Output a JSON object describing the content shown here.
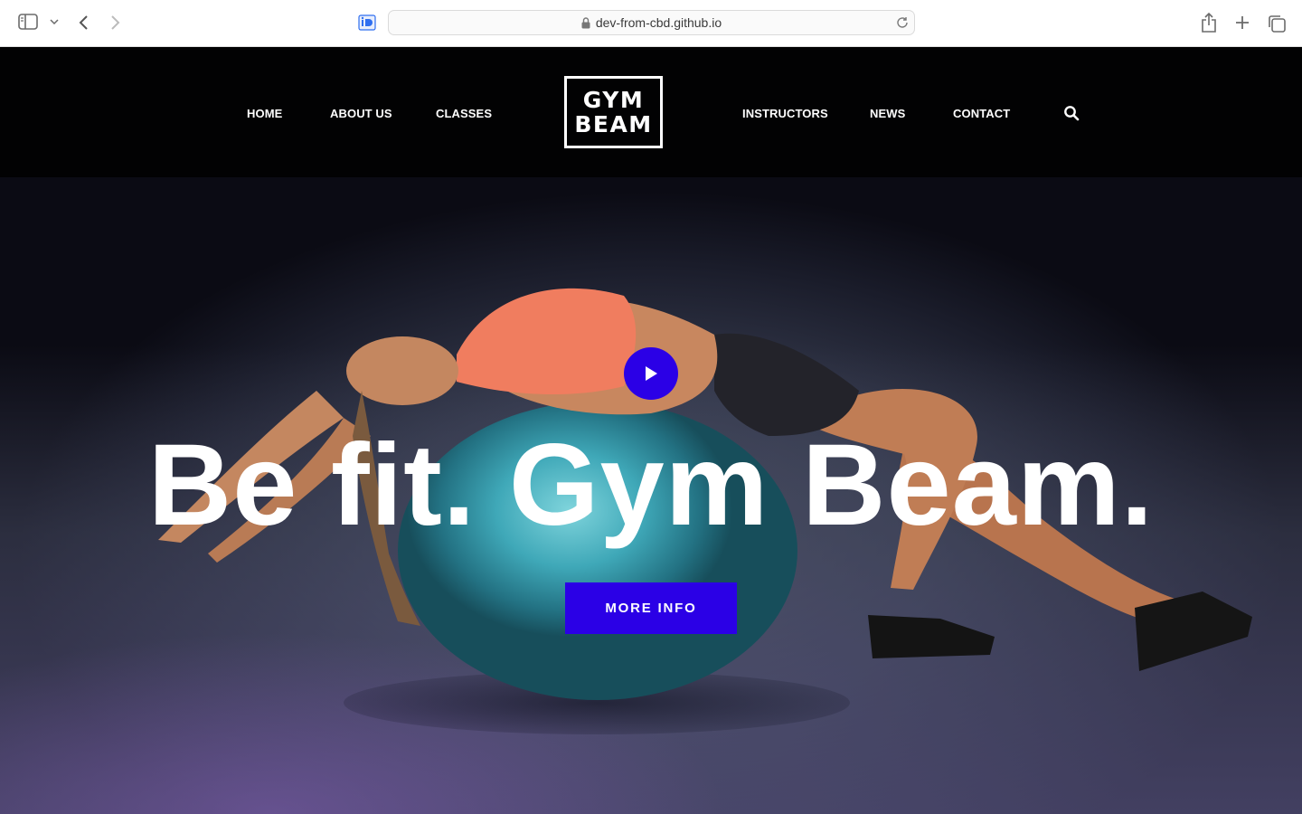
{
  "browser": {
    "url": "dev-from-cbd.github.io",
    "icons": [
      "sidebar-icon",
      "chevron-down-icon",
      "back-arrow-icon",
      "forward-arrow-icon",
      "extension-icon",
      "lock-icon",
      "reload-icon",
      "share-icon",
      "plus-icon",
      "tabs-icon"
    ]
  },
  "nav": {
    "links": [
      "HOME",
      "ABOUT US",
      "CLASSES",
      "INSTRUCTORS",
      "NEWS",
      "CONTACT"
    ],
    "logo_line1": "GYM",
    "logo_line2": "BEAM",
    "search_icon": "search-icon"
  },
  "hero": {
    "headline": "Be fit. Gym Beam.",
    "cta_label": "MORE INFO",
    "play_icon": "play-icon"
  },
  "colors": {
    "accent": "#2b00e6",
    "nav_bg": "#000000",
    "text": "#ffffff"
  }
}
